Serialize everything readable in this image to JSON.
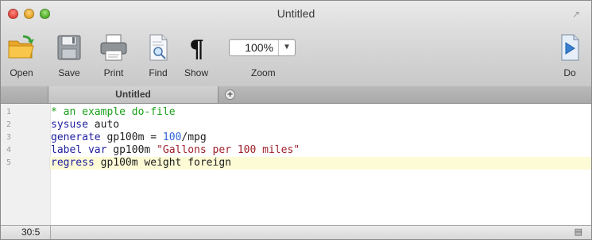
{
  "window": {
    "title": "Untitled",
    "fullscreen_icon": "fullscreen-arrows-icon"
  },
  "toolbar": {
    "open_label": "Open",
    "save_label": "Save",
    "print_label": "Print",
    "find_label": "Find",
    "show_label": "Show",
    "zoom_value": "100%",
    "zoom_label": "Zoom",
    "do_label": "Do"
  },
  "tabs": {
    "active_label": "Untitled"
  },
  "editor": {
    "lines": [
      {
        "num": "1"
      },
      {
        "num": "2"
      },
      {
        "num": "3"
      },
      {
        "num": "4"
      },
      {
        "num": "5"
      }
    ],
    "code": {
      "l1_comment": "* an example do-file",
      "l2_kw": "sysuse",
      "l2_rest": " auto",
      "l3_kw": "generate",
      "l3_rest": " gp100m = ",
      "l3_num": "100",
      "l3_tail": "/mpg",
      "l4_kw": "label var",
      "l4_rest": " gp100m ",
      "l4_str": "\"Gallons per 100 miles\"",
      "l5_kw": "regress",
      "l5_rest": " gp100m weight foreign"
    },
    "current_line": 5
  },
  "status": {
    "position": "30:5"
  },
  "colors": {
    "comment": "#1aa01a",
    "keyword": "#1d1d9e",
    "number": "#2f67d6",
    "string": "#9e1f2a",
    "current_line": "#fdfbd6"
  }
}
